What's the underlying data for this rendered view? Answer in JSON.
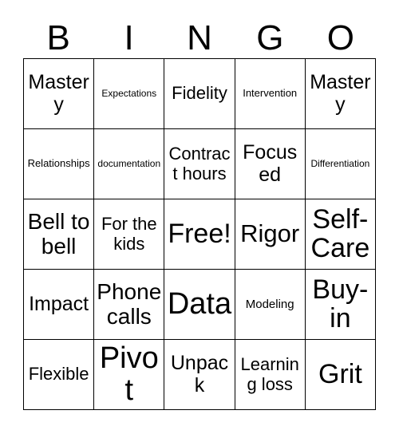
{
  "card": {
    "header_letters": [
      "B",
      "I",
      "N",
      "G",
      "O"
    ],
    "grid": {
      "rows": 5,
      "columns": 5,
      "border_color": "#000000",
      "background_color": "#ffffff",
      "text_color": "#000000"
    },
    "cells": [
      {
        "text": "Mastery",
        "size": "xl"
      },
      {
        "text": "Expectations",
        "size": "xs"
      },
      {
        "text": "Fidelity",
        "size": "l"
      },
      {
        "text": "Intervention",
        "size": "s"
      },
      {
        "text": "Mastery",
        "size": "xl"
      },
      {
        "text": "Relationships",
        "size": "s"
      },
      {
        "text": "documentation",
        "size": "xs"
      },
      {
        "text": "Contract hours",
        "size": "l"
      },
      {
        "text": "Focused",
        "size": "xl"
      },
      {
        "text": "Differentiation",
        "size": "xs"
      },
      {
        "text": "Bell to bell",
        "size": "2xl"
      },
      {
        "text": "For the kids",
        "size": "l"
      },
      {
        "text": "Free!",
        "size": "4xl"
      },
      {
        "text": "Rigor",
        "size": "3xl"
      },
      {
        "text": "Self-Care",
        "size": "4xl"
      },
      {
        "text": "Impact",
        "size": "xl"
      },
      {
        "text": "Phone calls",
        "size": "2xl"
      },
      {
        "text": "Data",
        "size": "5xl"
      },
      {
        "text": "Modeling",
        "size": "m"
      },
      {
        "text": "Buy-in",
        "size": "4xl"
      },
      {
        "text": "Flexible",
        "size": "l"
      },
      {
        "text": "Pivot",
        "size": "5xl"
      },
      {
        "text": "Unpack",
        "size": "xl"
      },
      {
        "text": "Learning loss",
        "size": "l"
      },
      {
        "text": "Grit",
        "size": "4xl"
      }
    ]
  }
}
